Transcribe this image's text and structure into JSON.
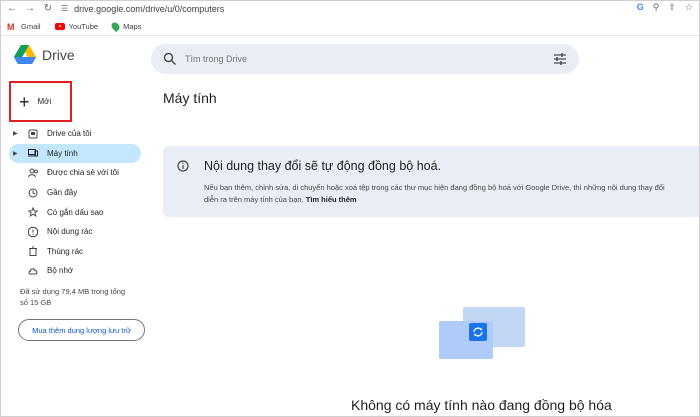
{
  "browser": {
    "url": "drive.google.com/drive/u/0/computers",
    "bookmarks": [
      {
        "label": "Gmail",
        "icon": "gmail-icon"
      },
      {
        "label": "YouTube",
        "icon": "youtube-icon"
      },
      {
        "label": "Maps",
        "icon": "maps-icon"
      }
    ]
  },
  "app": {
    "name": "Drive"
  },
  "search": {
    "placeholder": "Tìm trong Drive"
  },
  "new_button": {
    "label": "Mới"
  },
  "sidebar": {
    "items": [
      {
        "label": "Drive của tôi",
        "icon": "my-drive-icon",
        "expandable": true
      },
      {
        "label": "Máy tính",
        "icon": "computers-icon",
        "expandable": true,
        "active": true
      },
      {
        "label": "Được chia sẻ với tôi",
        "icon": "shared-icon"
      },
      {
        "label": "Gần đây",
        "icon": "recent-icon"
      },
      {
        "label": "Có gắn dấu sao",
        "icon": "star-icon"
      },
      {
        "label": "Nội dung rác",
        "icon": "spam-icon"
      },
      {
        "label": "Thùng rác",
        "icon": "trash-icon"
      },
      {
        "label": "Bộ nhớ",
        "icon": "cloud-icon"
      }
    ],
    "storage_text": "Đã sử dụng 79,4 MB trong tổng số 15 GB",
    "buy_storage_label": "Mua thêm dung lượng lưu trữ"
  },
  "main": {
    "title": "Máy tính",
    "banner": {
      "title": "Nội dung thay đổi sẽ tự động đồng bộ hoá.",
      "body_line1": "Nếu bạn thêm, chỉnh sửa, di chuyển hoặc xoá tệp trong các thư mục hiện đang đồng bộ hoá với Google Drive, thì những nội dung thay đổi",
      "body_line2": "diễn ra trên máy tính của bạn.",
      "link": "Tìm hiểu thêm"
    },
    "empty_state": "Không có máy tính nào đang đồng bộ hóa"
  },
  "colors": {
    "accent": "#0b57d0",
    "active_nav": "#c2e7ff",
    "search_bg": "#e9eef6",
    "highlight_border": "#e02020"
  }
}
